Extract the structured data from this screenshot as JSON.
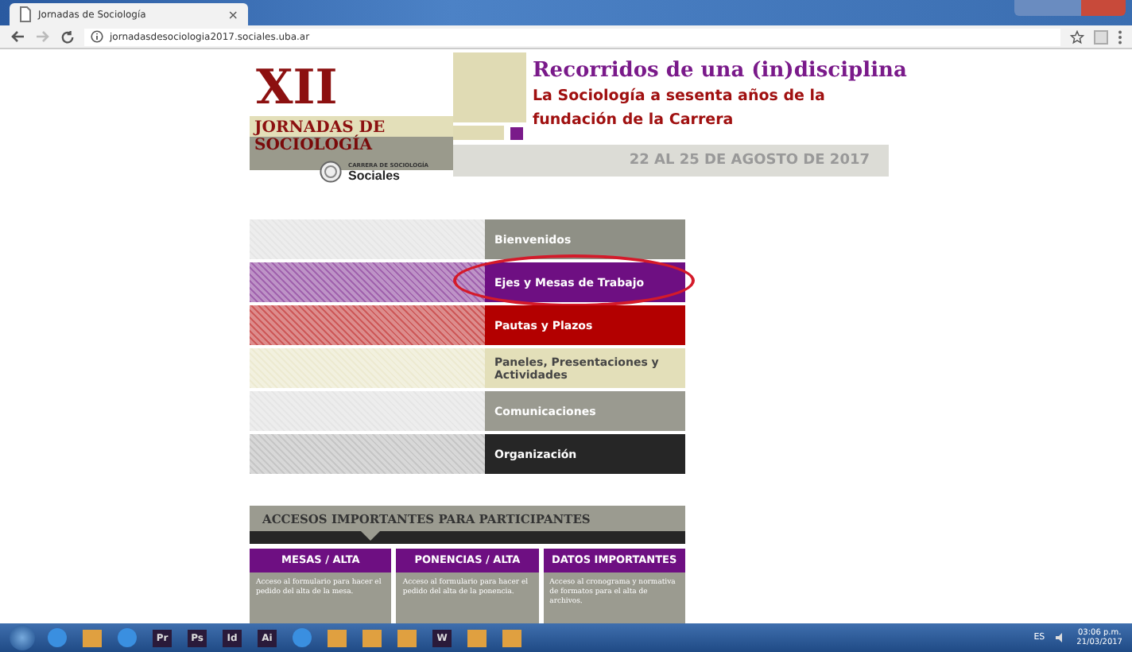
{
  "browser": {
    "tab": {
      "title": "Jornadas de Sociología",
      "close": "×"
    },
    "address": "jornadasdesociologia2017.sociales.uba.ar"
  },
  "header": {
    "edition": "XII",
    "name_line1": "JORNADAS DE",
    "name_line2": "SOCIOLOGÍA",
    "logo_top": "CARRERA DE SOCIOLOGÍA",
    "logo_main": "Sociales",
    "title": "Recorridos de una (in)disciplina",
    "subtitle": "La Sociología a sesenta años de la fundación de la Carrera",
    "dates": "22 AL 25 DE AGOSTO DE 2017"
  },
  "menu": [
    {
      "label": "Bienvenidos",
      "color": "#8f9086",
      "highlighted": false
    },
    {
      "label": "Ejes y Mesas de Trabajo",
      "color": "#6e0f82",
      "highlighted": true
    },
    {
      "label": "Pautas y Plazos",
      "color": "#b30000",
      "highlighted": false
    },
    {
      "label": "Paneles, Presentaciones y Actividades",
      "color": "#e3dfb9",
      "highlighted": false
    },
    {
      "label": "Comunicaciones",
      "color": "#9a9a90",
      "highlighted": false
    },
    {
      "label": "Organización",
      "color": "#262626",
      "highlighted": false
    }
  ],
  "access": {
    "title": "ACCESOS IMPORTANTES PARA PARTICIPANTES",
    "cards": [
      {
        "title": "MESAS / ALTA",
        "text": "Acceso al formulario para hacer el pedido del alta de la mesa."
      },
      {
        "title": "PONENCIAS / ALTA",
        "text": "Acceso al formulario para hacer el pedido del alta de la ponencia."
      },
      {
        "title": "DATOS IMPORTANTES",
        "text": "Acceso al cronograma y normativa de formatos para el alta de archivos."
      }
    ]
  },
  "taskbar": {
    "apps": [
      {
        "kind": "round"
      },
      {
        "kind": "square"
      },
      {
        "kind": "round"
      },
      {
        "kind": "letter",
        "label": "Pr"
      },
      {
        "kind": "letter",
        "label": "Ps"
      },
      {
        "kind": "letter",
        "label": "Id"
      },
      {
        "kind": "letter",
        "label": "Ai"
      },
      {
        "kind": "round"
      },
      {
        "kind": "square"
      },
      {
        "kind": "square"
      },
      {
        "kind": "square"
      },
      {
        "kind": "letter",
        "label": "W"
      },
      {
        "kind": "square"
      },
      {
        "kind": "square"
      }
    ],
    "language": "ES",
    "time": "03:06 p.m.",
    "date": "21/03/2017"
  }
}
